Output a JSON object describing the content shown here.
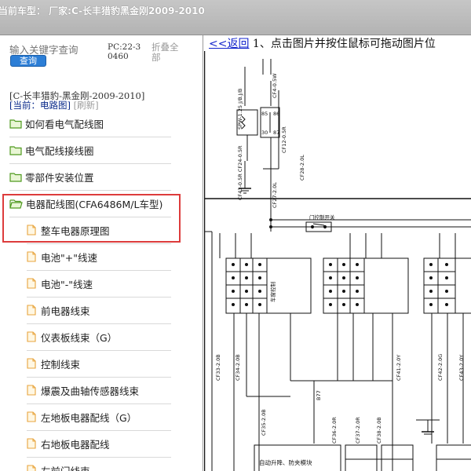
{
  "header": {
    "title": "当前车型：  厂家:C-长丰猎豹黑金刚2009-2010"
  },
  "sidebar": {
    "search": {
      "placeholder": "输入关键字查询",
      "button_label": "查询"
    },
    "pc_code": "PC:22-30460",
    "collapse_all": "折叠全部",
    "breadcrumb": {
      "model": "[C-长丰猎豹-黑金刚-2009-2010]",
      "current": "[当前：电路图]",
      "refresh": "[刷新]"
    },
    "items": [
      {
        "label": "如何看电气配线图",
        "type": "folder"
      },
      {
        "label": "电气配线接线圈",
        "type": "folder"
      },
      {
        "label": "零部件安装位置",
        "type": "folder"
      },
      {
        "label": "电器配线图(CFA6486M/L车型)",
        "type": "folder-open"
      },
      {
        "label": "整车电器原理图",
        "type": "file"
      },
      {
        "label": "电池\"+\"线速",
        "type": "file"
      },
      {
        "label": "电池\"-\"线速",
        "type": "file"
      },
      {
        "label": "前电器线束",
        "type": "file"
      },
      {
        "label": "仪表板线束（G）",
        "type": "file"
      },
      {
        "label": "控制线束",
        "type": "file"
      },
      {
        "label": "爆震及曲轴传感器线束",
        "type": "file"
      },
      {
        "label": "左地板电器配线（G）",
        "type": "file"
      },
      {
        "label": "右地板电器配线",
        "type": "file"
      },
      {
        "label": "左前门线束",
        "type": "file"
      }
    ]
  },
  "content": {
    "back_link": "<<返回",
    "instruction": " 1、点击图片并按住鼠标可拖动图片位",
    "diagram": {
      "labels": {
        "w1": "SPW-1.25 J/B.J/B",
        "w2": "CF4-0.5W",
        "relay_pins": [
          "85",
          "86",
          "30",
          "87"
        ],
        "w3": "CF43-0.5R CF24-0.5R",
        "w4": "CF12-0.5R",
        "w5": "CF27-2.0L",
        "w6": "CF28-2.0L",
        "switch_label": "门控制开关",
        "left_wires": [
          "CF33-2.0B",
          "CF34-2.0B",
          "CF35-2.0B"
        ],
        "mid_wires": [
          "CF36-2.0R",
          "CF37-2.0R",
          "CF38-2.0B"
        ],
        "right_wires": [
          "CF41-2.0Y",
          "CF42-2.0G",
          "CF43-2.0Y"
        ],
        "fuse_label": "B77",
        "module_label": "自动升降、防夹模块",
        "box_label": "车窗控制"
      }
    }
  },
  "colors": {
    "accent": "#2c7ed6",
    "highlight": "#dd3c3c",
    "link": "#1122cc",
    "header": "#bdbdbd"
  }
}
